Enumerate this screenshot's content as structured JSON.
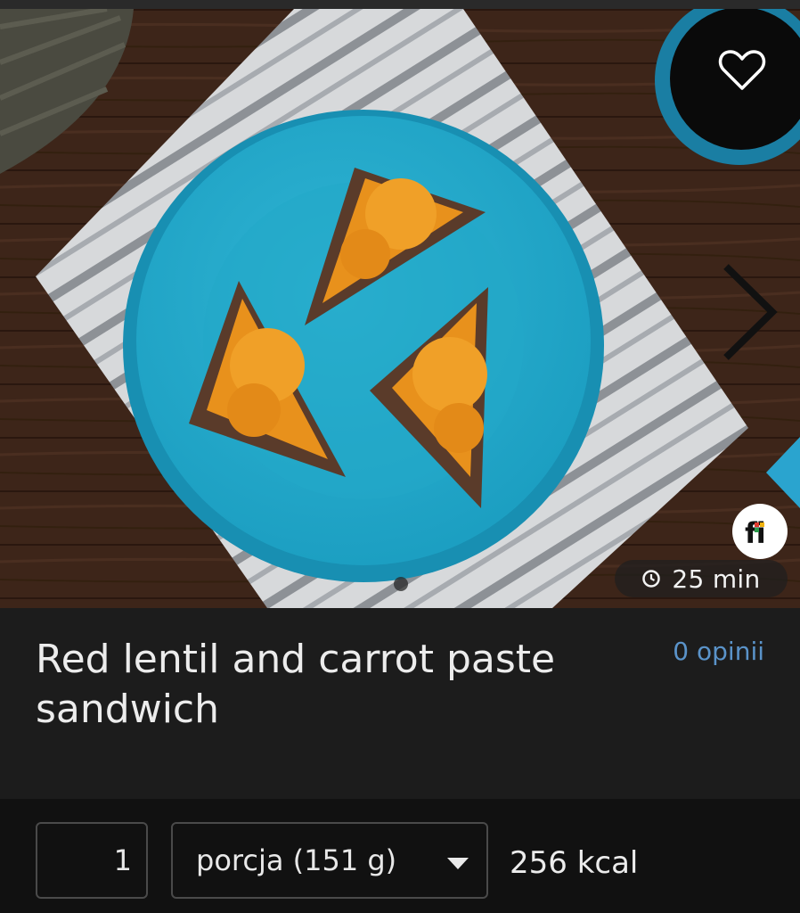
{
  "recipe": {
    "title": "Red lentil and carrot paste sandwich",
    "reviews_label": "0 opinii",
    "prep_time": "25 min"
  },
  "serving": {
    "quantity": "1",
    "unit_selected": "porcja (151 g)",
    "calories": "256 kcal"
  },
  "icons": {
    "favorite": "heart-outline-icon",
    "next": "chevron-right-icon",
    "clock": "clock-icon",
    "logo": "fi-logo-icon",
    "dropdown": "caret-down-icon"
  },
  "colors": {
    "background": "#1c1c1c",
    "controls_background": "#111111",
    "link": "#5a93c9",
    "text": "#ececec"
  }
}
